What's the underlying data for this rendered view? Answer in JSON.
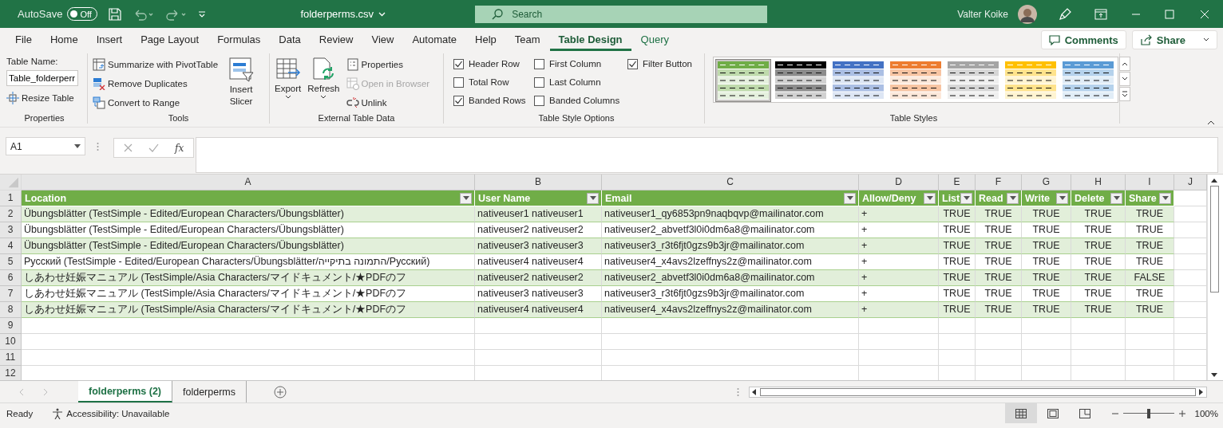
{
  "title_bar": {
    "autosave": {
      "label": "AutoSave",
      "on": false,
      "state_text": "Off"
    },
    "file_name": "folderperms.csv",
    "search": {
      "placeholder": "Search"
    },
    "user_name": "Valter Koike"
  },
  "ribbon_tabs": [
    {
      "label": "File",
      "selected": false,
      "contextual": false
    },
    {
      "label": "Home",
      "selected": false,
      "contextual": false
    },
    {
      "label": "Insert",
      "selected": false,
      "contextual": false
    },
    {
      "label": "Page Layout",
      "selected": false,
      "contextual": false
    },
    {
      "label": "Formulas",
      "selected": false,
      "contextual": false
    },
    {
      "label": "Data",
      "selected": false,
      "contextual": false
    },
    {
      "label": "Review",
      "selected": false,
      "contextual": false
    },
    {
      "label": "View",
      "selected": false,
      "contextual": false
    },
    {
      "label": "Automate",
      "selected": false,
      "contextual": false
    },
    {
      "label": "Help",
      "selected": false,
      "contextual": false
    },
    {
      "label": "Team",
      "selected": false,
      "contextual": false
    },
    {
      "label": "Table Design",
      "selected": true,
      "contextual": true
    },
    {
      "label": "Query",
      "selected": false,
      "contextual": true
    }
  ],
  "ribbon_actions": {
    "comments": "Comments",
    "share": "Share"
  },
  "properties_group": {
    "title": "Properties",
    "table_name_label": "Table Name:",
    "table_name": "Table_folderperr",
    "resize": "Resize Table"
  },
  "tools_group": {
    "title": "Tools",
    "commands": [
      {
        "label": "Summarize with PivotTable",
        "kind": "pivot"
      },
      {
        "label": "Remove Duplicates",
        "kind": "dedupe"
      },
      {
        "label": "Convert to Range",
        "kind": "convert"
      }
    ],
    "insert_slicer": "Insert Slicer"
  },
  "external_group": {
    "title": "External Table Data",
    "export": "Export",
    "refresh": "Refresh",
    "commands": [
      {
        "label": "Properties",
        "kind": "properties",
        "disabled": false
      },
      {
        "label": "Open in Browser",
        "kind": "browser",
        "disabled": true
      },
      {
        "label": "Unlink",
        "kind": "unlink",
        "disabled": false
      }
    ]
  },
  "style_options": {
    "title": "Table Style Options",
    "options": [
      {
        "label": "Header Row",
        "kind": "header_row",
        "checked": true
      },
      {
        "label": "Total Row",
        "kind": "total_row",
        "checked": false
      },
      {
        "label": "Banded Rows",
        "kind": "banded_rows",
        "checked": true
      },
      {
        "label": "First Column",
        "kind": "first_column",
        "checked": false
      },
      {
        "label": "Last Column",
        "kind": "last_column",
        "checked": false
      },
      {
        "label": "Banded Columns",
        "kind": "banded_columns",
        "checked": false
      },
      {
        "label": "Filter Button",
        "kind": "filter_button",
        "checked": true
      }
    ]
  },
  "table_styles": {
    "title": "Table Styles",
    "styles": [
      {
        "color": "#70ad47",
        "selected": true
      },
      {
        "color": "#000000",
        "selected": false
      },
      {
        "color": "#4472c4",
        "selected": false
      },
      {
        "color": "#ed7d31",
        "selected": false
      },
      {
        "color": "#a5a5a5",
        "selected": false
      },
      {
        "color": "#ffc000",
        "selected": false
      },
      {
        "color": "#5b9bd5",
        "selected": false
      }
    ]
  },
  "formula_bar": {
    "name_box": "A1",
    "function_label": "fx"
  },
  "sheet": {
    "column_letters": [
      "A",
      "B",
      "C",
      "D",
      "E",
      "F",
      "G",
      "H",
      "I",
      "J"
    ],
    "header_row_number": "1",
    "header": [
      "Location",
      "User Name",
      "Email",
      "Allow/Deny",
      "List",
      "Read",
      "Write",
      "Delete",
      "Share"
    ],
    "rows": [
      {
        "row_number": "2",
        "cells": [
          "Übungsblätter (TestSimple - Edited/European Characters/Übungsblätter)",
          "nativeuser1 nativeuser1",
          "nativeuser1_qy6853pn9naqbqvp@mailinator.com",
          "+",
          "TRUE",
          "TRUE",
          "TRUE",
          "TRUE",
          "TRUE"
        ]
      },
      {
        "row_number": "3",
        "cells": [
          "Übungsblätter (TestSimple - Edited/European Characters/Übungsblätter)",
          "nativeuser2 nativeuser2",
          "nativeuser2_abvetf3l0i0dm6a8@mailinator.com",
          "+",
          "TRUE",
          "TRUE",
          "TRUE",
          "TRUE",
          "TRUE"
        ]
      },
      {
        "row_number": "4",
        "cells": [
          "Übungsblätter (TestSimple - Edited/European Characters/Übungsblätter)",
          "nativeuser3 nativeuser3",
          "nativeuser3_r3t6fjt0gzs9b3jr@mailinator.com",
          "+",
          "TRUE",
          "TRUE",
          "TRUE",
          "TRUE",
          "TRUE"
        ]
      },
      {
        "row_number": "5",
        "cells": [
          "Русский (TestSimple - Edited/European Characters/Übungsblätter/התמונה בתיקייה/Русский)",
          "nativeuser4 nativeuser4",
          "nativeuser4_x4avs2lzeffnys2z@mailinator.com",
          "+",
          "TRUE",
          "TRUE",
          "TRUE",
          "TRUE",
          "TRUE"
        ]
      },
      {
        "row_number": "6",
        "cells": [
          "しあわせ妊娠マニュアル (TestSimple/Asia Characters/マイドキュメント/★PDFのフ",
          "nativeuser2 nativeuser2",
          "nativeuser2_abvetf3l0i0dm6a8@mailinator.com",
          "+",
          "TRUE",
          "TRUE",
          "TRUE",
          "TRUE",
          "FALSE"
        ]
      },
      {
        "row_number": "7",
        "cells": [
          "しあわせ妊娠マニュアル (TestSimple/Asia Characters/マイドキュメント/★PDFのフ",
          "nativeuser3 nativeuser3",
          "nativeuser3_r3t6fjt0gzs9b3jr@mailinator.com",
          "+",
          "TRUE",
          "TRUE",
          "TRUE",
          "TRUE",
          "TRUE"
        ]
      },
      {
        "row_number": "8",
        "cells": [
          "しあわせ妊娠マニュアル (TestSimple/Asia Characters/マイドキュメント/★PDFのフ",
          "nativeuser4 nativeuser4",
          "nativeuser4_x4avs2lzeffnys2z@mailinator.com",
          "+",
          "TRUE",
          "TRUE",
          "TRUE",
          "TRUE",
          "TRUE"
        ]
      }
    ],
    "empty_rows": [
      "9",
      "10",
      "11",
      "12"
    ]
  },
  "sheet_tabs": [
    {
      "label": "folderperms (2)",
      "selected": true
    },
    {
      "label": "folderperms",
      "selected": false
    }
  ],
  "status_bar": {
    "mode": "Ready",
    "accessibility": "Accessibility: Unavailable",
    "zoom": {
      "level": 0.5,
      "reading": "100%"
    }
  }
}
